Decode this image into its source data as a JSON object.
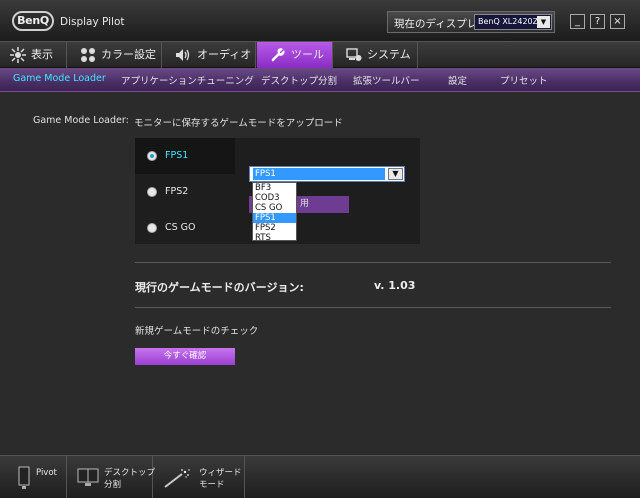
{
  "app": {
    "brand": "BenQ",
    "title": "Display Pilot"
  },
  "display_selector": {
    "label": "現在のディスプレイ",
    "value": "BenQ XL2420Z"
  },
  "window_controls": {
    "minimize": "_",
    "help": "?",
    "close": "×"
  },
  "main_tabs": [
    {
      "label": "表示",
      "icon": "display-icon"
    },
    {
      "label": "カラー設定",
      "icon": "color-icon"
    },
    {
      "label": "オーディオ",
      "icon": "speaker-icon"
    },
    {
      "label": "ツール",
      "icon": "wrench-icon",
      "active": true
    },
    {
      "label": "システム",
      "icon": "system-icon"
    }
  ],
  "sub_tabs": [
    {
      "label": "Game Mode Loader",
      "active": true
    },
    {
      "label": "アプリケーションチューニング"
    },
    {
      "label": "デスクトップ分割"
    },
    {
      "label": "拡張ツールバー"
    },
    {
      "label": "設定"
    },
    {
      "label": "プリセット"
    }
  ],
  "game_mode": {
    "label": "Game Mode Loader:",
    "description": "モニターに保存するゲームモードをアップロード",
    "modes": [
      {
        "label": "FPS1",
        "selected": true
      },
      {
        "label": "FPS2",
        "selected": false
      },
      {
        "label": "CS GO",
        "selected": false
      }
    ],
    "combo_value": "FPS1",
    "dropdown_options": [
      "BF3",
      "COD3",
      "CS GO",
      "FPS1",
      "FPS2",
      "RTS"
    ],
    "dropdown_highlighted": "FPS1",
    "apply_label": "用"
  },
  "version": {
    "label": "現行のゲームモードのバージョン:",
    "value": "v. 1.03"
  },
  "check": {
    "label": "新規ゲームモードのチェック",
    "button": "今すぐ確認"
  },
  "bottom_bar": [
    {
      "label": "Pivot",
      "icon": "pivot-icon"
    },
    {
      "label_line1": "デスクトップ",
      "label_line2": "分割",
      "icon": "desktop-split-icon"
    },
    {
      "label_line1": "ウィザード",
      "label_line2": "モード",
      "icon": "wizard-wand-icon"
    }
  ],
  "colors": {
    "accent_purple": "#9a3fd0",
    "active_cyan": "#3ee8ff",
    "selection_blue": "#3399ff"
  }
}
